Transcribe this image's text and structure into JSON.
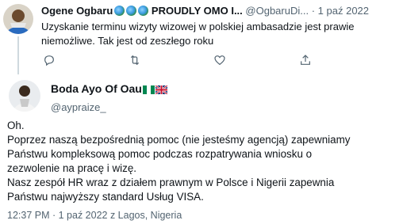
{
  "parent_tweet": {
    "author_name": "Ogene Ogbaru",
    "author_suffix": "PROUDLY OMO I...",
    "handle": "@OgbaruDi...",
    "separator": "·",
    "date": "1 paź 2022",
    "text_line1": "Uzyskanie terminu wizyty wizowej w polskiej ambasadzie jest prawie",
    "text_line2": "niemożliwe. Tak jest od zeszłego roku",
    "actions": [
      {
        "icon": "reply-icon",
        "count": ""
      },
      {
        "icon": "retweet-icon",
        "count": ""
      },
      {
        "icon": "like-icon",
        "count": ""
      },
      {
        "icon": "share-icon",
        "count": ""
      }
    ]
  },
  "main_tweet": {
    "author_name": "Boda Ayo Of Oau",
    "flags": [
      "nigeria-flag-icon",
      "uk-flag-icon"
    ],
    "handle": "@aypraize_",
    "lines": [
      "Oh.",
      "Poprzez naszą bezpośrednią pomoc (nie jesteśmy agencją) zapewniamy",
      "Państwu kompleksową pomoc podczas rozpatrywania wniosku o",
      "zezwolenie na pracę i wizę.",
      "Nasz zespół HR wraz z działem prawnym w Polsce i Nigerii zapewnia",
      "Państwu najwyższy standard Usług VISA."
    ],
    "meta": "12:37 PM · 1 paź 2022 z Lagos, Nigeria"
  },
  "colors": {
    "text": "#0f1419",
    "secondary": "#536471",
    "thread_line": "#cfd9de",
    "background": "#ffffff"
  }
}
